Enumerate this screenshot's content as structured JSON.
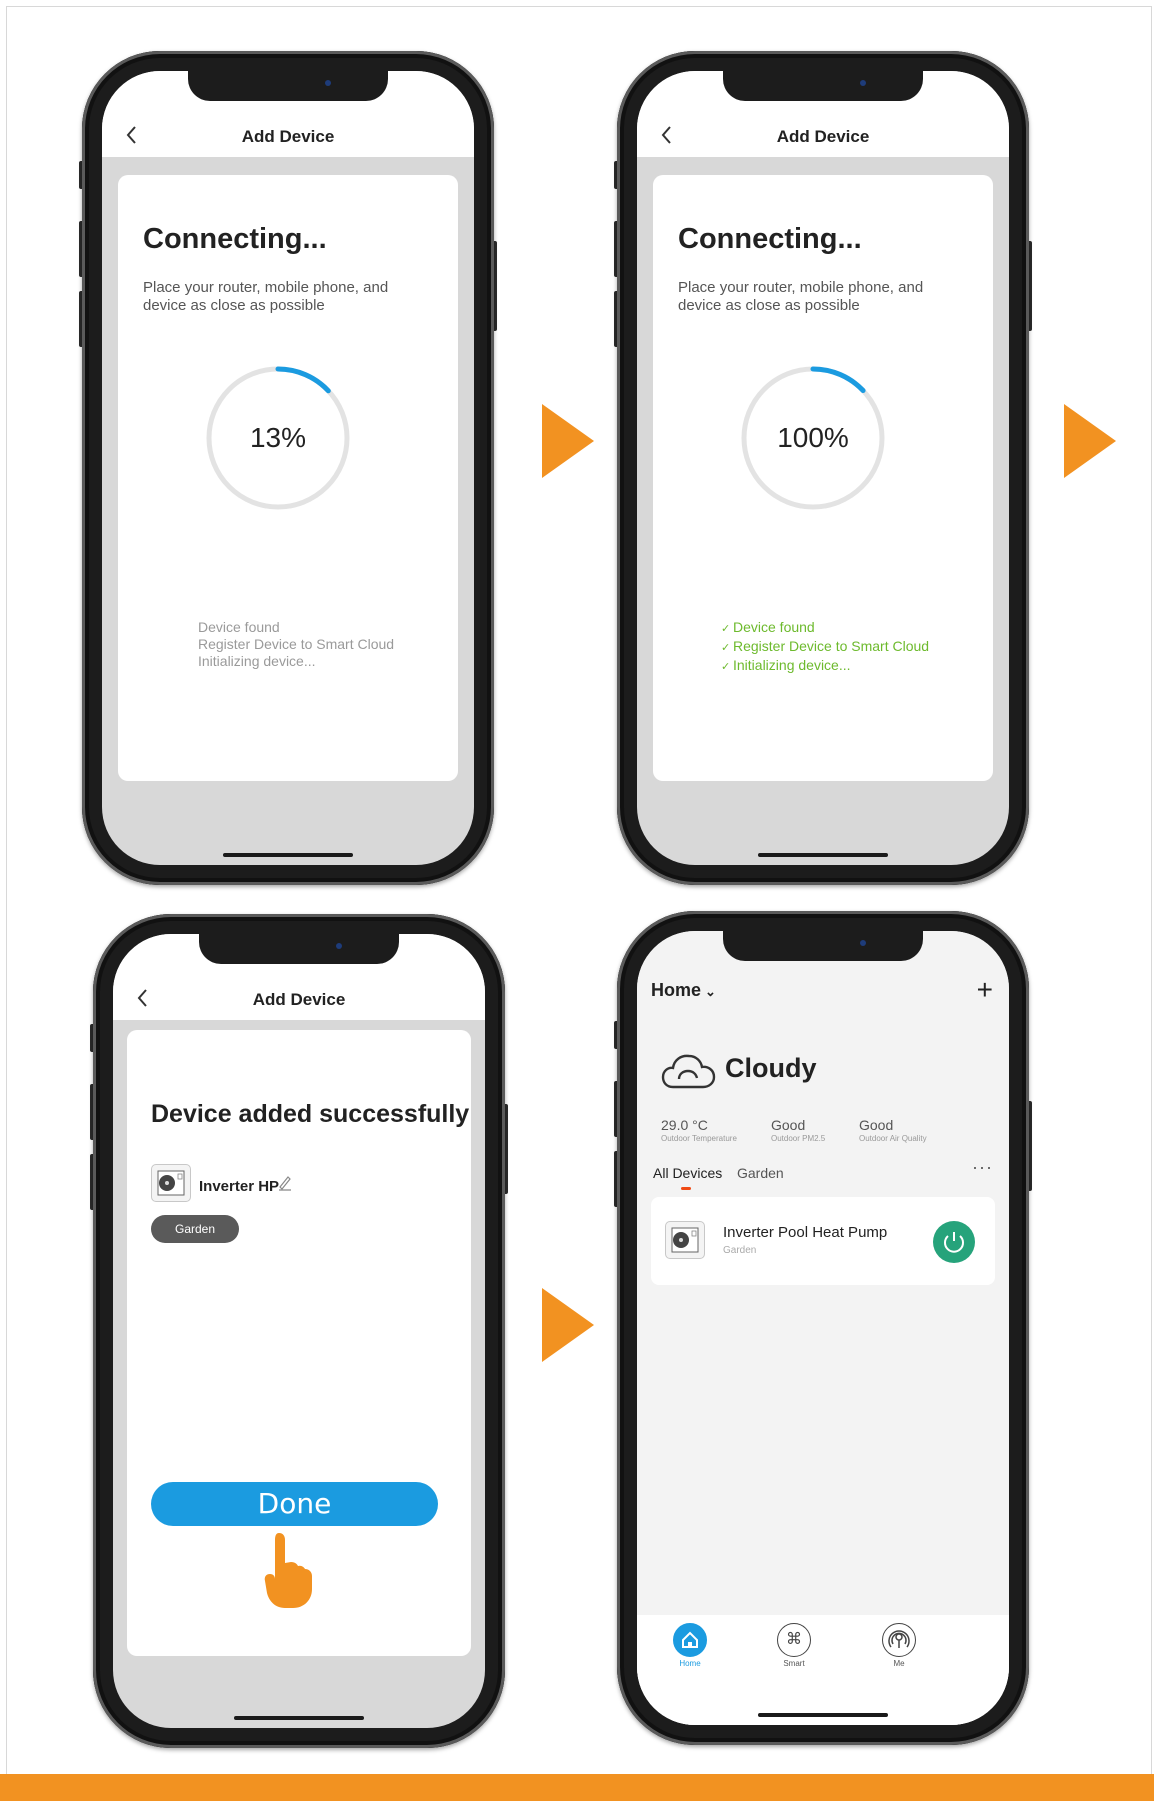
{
  "colors": {
    "accent_orange": "#f29221",
    "blue": "#1b9be0",
    "progress_blue": "#1b9be0",
    "success_green": "#6dba2d",
    "power_green": "#26a37b",
    "tab_orange": "#f04a14"
  },
  "phone1": {
    "title": "Add Device",
    "heading": "Connecting...",
    "description": "Place your router, mobile phone, and device as close as possible",
    "progress_text": "13%",
    "progress_fraction": 0.13,
    "steps": [
      "Device found",
      "Register Device to Smart Cloud",
      "Initializing device..."
    ]
  },
  "phone2": {
    "title": "Add Device",
    "heading": "Connecting...",
    "description": "Place your router, mobile phone, and device as close as possible",
    "progress_text": "100%",
    "steps": [
      "Device found",
      "Register Device to Smart Cloud",
      "Initializing device..."
    ]
  },
  "phone3": {
    "title": "Add Device",
    "heading": "Device added successfully",
    "device_name": "Inverter HP",
    "room": "Garden",
    "done_label": "Done"
  },
  "phone4": {
    "home_label": "Home",
    "weather": "Cloudy",
    "metrics": [
      {
        "value": "29.0 °C",
        "label": "Outdoor Temperature"
      },
      {
        "value": "Good",
        "label": "Outdoor PM2.5"
      },
      {
        "value": "Good",
        "label": "Outdoor Air Quality"
      }
    ],
    "tabs": [
      "All Devices",
      "Garden"
    ],
    "device_name": "Inverter Pool Heat Pump",
    "device_room": "Garden",
    "nav": [
      "Home",
      "Smart",
      "Me"
    ]
  },
  "icons": [
    "back-icon",
    "progress-ring-icon",
    "check-icon",
    "arrow-right-icon",
    "heat-pump-icon",
    "pencil-icon",
    "hand-pointer-icon",
    "chevron-down-icon",
    "plus-icon",
    "cloud-icon",
    "more-icon",
    "power-icon",
    "home-icon",
    "smart-icon",
    "me-icon"
  ]
}
